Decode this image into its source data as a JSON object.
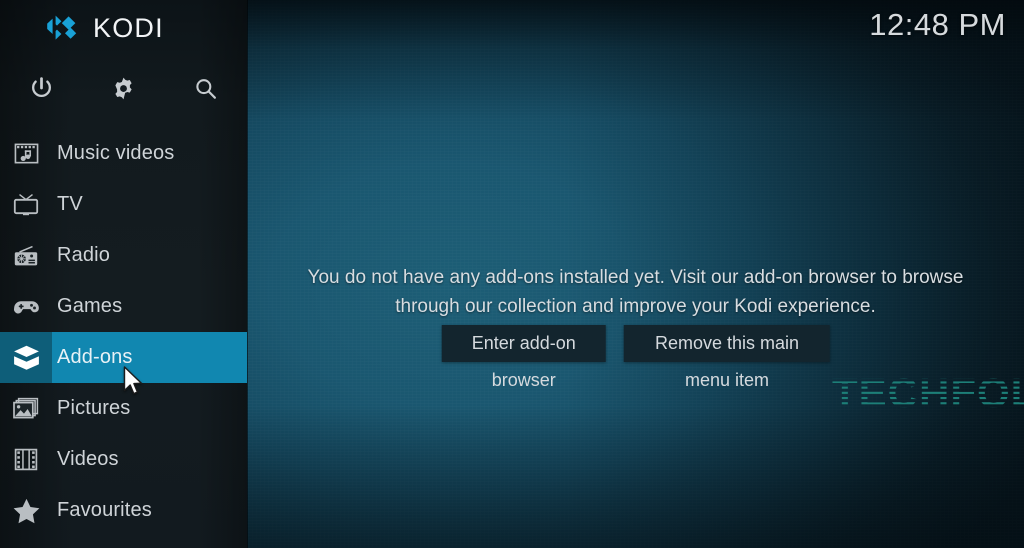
{
  "app": {
    "name": "KODI",
    "logo_color": "#19a1d6"
  },
  "clock": {
    "time": "12:48 PM"
  },
  "toolbar": {
    "items": [
      {
        "name": "power-icon",
        "label": "Power"
      },
      {
        "name": "gear-icon",
        "label": "Settings"
      },
      {
        "name": "search-icon",
        "label": "Search"
      }
    ]
  },
  "sidebar": {
    "items": [
      {
        "label": "Music videos",
        "icon": "music-video-icon",
        "selected": false
      },
      {
        "label": "TV",
        "icon": "tv-icon",
        "selected": false
      },
      {
        "label": "Radio",
        "icon": "radio-icon",
        "selected": false
      },
      {
        "label": "Games",
        "icon": "gamepad-icon",
        "selected": false
      },
      {
        "label": "Add-ons",
        "icon": "addons-box-icon",
        "selected": true
      },
      {
        "label": "Pictures",
        "icon": "pictures-icon",
        "selected": false
      },
      {
        "label": "Videos",
        "icon": "film-strip-icon",
        "selected": false
      },
      {
        "label": "Favourites",
        "icon": "star-icon",
        "selected": false
      }
    ],
    "selected_color": "#1187b0",
    "selected_icon_color": "#0e5e79"
  },
  "main": {
    "empty_message": "You do not have any add-ons installed yet. Visit our add-on browser to browse through our collection and improve your Kodi experience.",
    "buttons": [
      {
        "label": "Enter add-on browser"
      },
      {
        "label": "Remove this main menu item"
      }
    ]
  },
  "watermark": {
    "text": "TECHFOLLOWS",
    "color": "#1d7f78"
  }
}
